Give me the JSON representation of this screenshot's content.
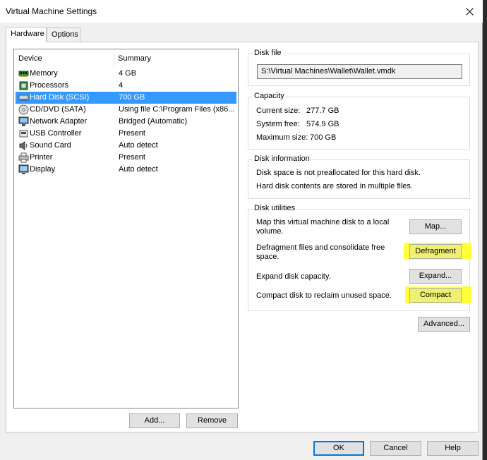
{
  "window": {
    "title": "Virtual Machine Settings"
  },
  "tabs": [
    {
      "label": "Hardware"
    },
    {
      "label": "Options"
    }
  ],
  "device_list": {
    "columns": {
      "device": "Device",
      "summary": "Summary"
    },
    "rows": [
      {
        "device": "Memory",
        "summary": "4 GB",
        "icon": "memory-icon"
      },
      {
        "device": "Processors",
        "summary": "4",
        "icon": "processor-icon"
      },
      {
        "device": "Hard Disk (SCSI)",
        "summary": "700 GB",
        "icon": "hard-disk-icon",
        "selected": true
      },
      {
        "device": "CD/DVD (SATA)",
        "summary": "Using file C:\\Program Files (x86...",
        "icon": "cd-dvd-icon"
      },
      {
        "device": "Network Adapter",
        "summary": "Bridged (Automatic)",
        "icon": "network-adapter-icon"
      },
      {
        "device": "USB Controller",
        "summary": "Present",
        "icon": "usb-icon"
      },
      {
        "device": "Sound Card",
        "summary": "Auto detect",
        "icon": "sound-card-icon"
      },
      {
        "device": "Printer",
        "summary": "Present",
        "icon": "printer-icon"
      },
      {
        "device": "Display",
        "summary": "Auto detect",
        "icon": "display-icon"
      }
    ],
    "add_label": "Add...",
    "remove_label": "Remove"
  },
  "disk_file": {
    "heading": "Disk file",
    "path": "S:\\Virtual Machines\\Wallet\\Wallet.vmdk"
  },
  "capacity": {
    "heading": "Capacity",
    "current_label": "Current size:",
    "current_value": "277.7 GB",
    "free_label": "System free:",
    "free_value": "574.9 GB",
    "max_label": "Maximum size:",
    "max_value": "700 GB"
  },
  "disk_info": {
    "heading": "Disk information",
    "line1": "Disk space is not preallocated for this hard disk.",
    "line2": "Hard disk contents are stored in multiple files."
  },
  "disk_utilities": {
    "heading": "Disk utilities",
    "map_text_1": "Map this virtual machine disk to a local",
    "map_text_2": "volume.",
    "map_label": "Map...",
    "defrag_text_1": "Defragment files and consolidate free",
    "defrag_text_2": "space.",
    "defrag_label": "Defragment",
    "expand_text": "Expand disk capacity.",
    "expand_label": "Expand...",
    "compact_text": "Compact disk to reclaim unused space.",
    "compact_label": "Compact"
  },
  "advanced_label": "Advanced...",
  "footer": {
    "ok_label": "OK",
    "cancel_label": "Cancel",
    "help_label": "Help"
  },
  "colors": {
    "selection": "#3399ff",
    "highlight": "#ffff3a",
    "default_button_border": "#0078d7"
  }
}
